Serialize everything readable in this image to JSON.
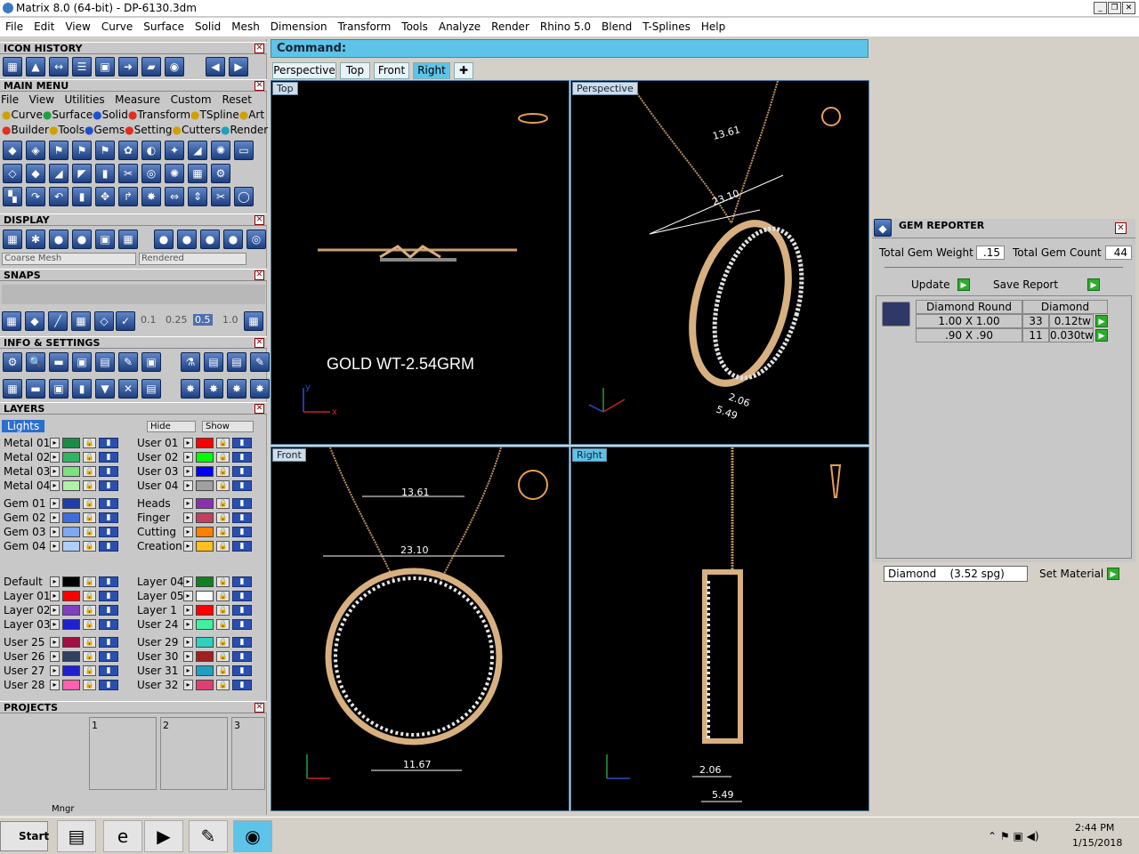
{
  "window": {
    "title": "Matrix 8.0 (64-bit) - DP-6130.3dm"
  },
  "menu": [
    "File",
    "Edit",
    "View",
    "Curve",
    "Surface",
    "Solid",
    "Mesh",
    "Dimension",
    "Transform",
    "Tools",
    "Analyze",
    "Render",
    "Rhino 5.0",
    "Blend",
    "T-Splines",
    "Help"
  ],
  "panels": {
    "icon_history": "ICON HISTORY",
    "main_menu": "MAIN MENU",
    "display": "DISPLAY",
    "snaps": "SNAPS",
    "info": "INFO & SETTINGS",
    "layers": "LAYERS",
    "projects": "PROJECTS"
  },
  "main_menu": {
    "row1": [
      "File",
      "View",
      "Utilities",
      "Measure",
      "Custom"
    ],
    "reset": "Reset",
    "row2": [
      "Curve",
      "Surface",
      "Solid",
      "Transform",
      "TSpline",
      "Art"
    ],
    "row3": [
      "Builder",
      "Tools",
      "Gems",
      "Setting",
      "Cutters",
      "Render"
    ]
  },
  "display": {
    "mesh": "Coarse Mesh",
    "mode": "Rendered"
  },
  "snaps": {
    "values": [
      "0.1",
      "0.25",
      "0.5",
      "1.0"
    ]
  },
  "layers": {
    "lights": "Lights",
    "hide": "Hide",
    "show": "Show",
    "left_group1": [
      {
        "name": "Metal 01",
        "color": "#1e8a4a"
      },
      {
        "name": "Metal 02",
        "color": "#2fb560"
      },
      {
        "name": "Metal 03",
        "color": "#7fe07f"
      },
      {
        "name": "Metal 04",
        "color": "#b0f0a8"
      }
    ],
    "right_group1": [
      {
        "name": "User 01",
        "color": "#ff0000"
      },
      {
        "name": "User 02",
        "color": "#00ff00"
      },
      {
        "name": "User 03",
        "color": "#0000ff"
      },
      {
        "name": "User 04",
        "color": "#a0a0a0"
      }
    ],
    "left_group2": [
      {
        "name": "Gem 01",
        "color": "#1e3fb0"
      },
      {
        "name": "Gem 02",
        "color": "#3d6ee0"
      },
      {
        "name": "Gem 03",
        "color": "#7fa8f0"
      },
      {
        "name": "Gem 04",
        "color": "#b0cff8"
      }
    ],
    "right_group2": [
      {
        "name": "Heads",
        "color": "#8a2fb0"
      },
      {
        "name": "Finger",
        "color": "#c04060"
      },
      {
        "name": "Cutting",
        "color": "#ff8000"
      },
      {
        "name": "Creation",
        "color": "#ffc020"
      }
    ],
    "left_group3": [
      {
        "name": "Default",
        "color": "#000000"
      },
      {
        "name": "Layer 01",
        "color": "#ff0000"
      },
      {
        "name": "Layer 02",
        "color": "#8040c0"
      },
      {
        "name": "Layer 03",
        "color": "#2020d0"
      }
    ],
    "right_group3": [
      {
        "name": "Layer 04",
        "color": "#108020"
      },
      {
        "name": "Layer 05",
        "color": "#ffffff"
      },
      {
        "name": "Layer 1",
        "color": "#ff0000"
      },
      {
        "name": "User 24",
        "color": "#40f0a0"
      }
    ],
    "left_group4": [
      {
        "name": "User 25",
        "color": "#a01040"
      },
      {
        "name": "User 26",
        "color": "#304060"
      },
      {
        "name": "User 27",
        "color": "#2020d0"
      },
      {
        "name": "User 28",
        "color": "#ff60b0"
      }
    ],
    "right_group4": [
      {
        "name": "User 29",
        "color": "#30d0c0"
      },
      {
        "name": "User 30",
        "color": "#a02020"
      },
      {
        "name": "User 31",
        "color": "#20a0c0"
      },
      {
        "name": "User 32",
        "color": "#e04070"
      }
    ]
  },
  "projects": {
    "slots": [
      "1",
      "2",
      "3"
    ],
    "mngr": "Mngr"
  },
  "command": {
    "label": "Command:"
  },
  "tabs": [
    "Perspective",
    "Top",
    "Front",
    "Right"
  ],
  "viewports": {
    "top": {
      "label": "Top",
      "note": "GOLD WT-2.54GRM"
    },
    "perspective": {
      "label": "Perspective",
      "dims": [
        "13.61",
        "23.10",
        "2.06",
        "5.49"
      ]
    },
    "front": {
      "label": "Front",
      "dims": [
        "13.61",
        "23.10",
        "11.67"
      ]
    },
    "right": {
      "label": "Right",
      "dims": [
        "2.06",
        "5.49"
      ]
    }
  },
  "gem_reporter": {
    "title": "GEM REPORTER",
    "weight_label": "Total Gem Weight",
    "weight": ".15",
    "count_label": "Total Gem Count",
    "count": "44",
    "update": "Update",
    "save": "Save Report",
    "head": [
      "Diamond Round",
      "Diamond"
    ],
    "rows": [
      {
        "size": "1.00 X 1.00",
        "qty": "33",
        "wt": "0.12tw"
      },
      {
        "size": ".90 X .90",
        "qty": "11",
        "wt": "0.030tw"
      }
    ],
    "material": "Diamond    (3.52 spg)",
    "set_material": "Set Material"
  },
  "taskbar": {
    "start": "Start",
    "time": "2:44 PM",
    "date": "1/15/2018"
  }
}
